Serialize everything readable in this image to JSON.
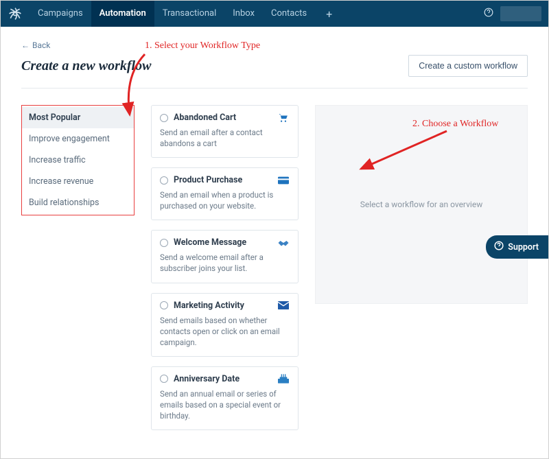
{
  "nav": {
    "tabs": [
      "Campaigns",
      "Automation",
      "Transactional",
      "Inbox",
      "Contacts"
    ],
    "active_index": 1
  },
  "back_label": "Back",
  "page_title": "Create a new workflow",
  "custom_button": "Create a custom workflow",
  "sidebar": {
    "items": [
      {
        "label": "Most Popular",
        "active": true
      },
      {
        "label": "Improve engagement",
        "active": false
      },
      {
        "label": "Increase traffic",
        "active": false
      },
      {
        "label": "Increase revenue",
        "active": false
      },
      {
        "label": "Build relationships",
        "active": false
      }
    ]
  },
  "workflows": [
    {
      "title": "Abandoned Cart",
      "desc": "Send an email after a contact abandons a cart",
      "icon": "cart-icon",
      "icon_color": "#1e73be"
    },
    {
      "title": "Product Purchase",
      "desc": "Send an email when a product is purchased on your website.",
      "icon": "card-icon",
      "icon_color": "#1e73be"
    },
    {
      "title": "Welcome Message",
      "desc": "Send a welcome email after a subscriber joins your list.",
      "icon": "handshake-icon",
      "icon_color": "#3b82c4"
    },
    {
      "title": "Marketing Activity",
      "desc": "Send emails based on whether contacts open or click on an email campaign.",
      "icon": "envelope-icon",
      "icon_color": "#1e5aa8"
    },
    {
      "title": "Anniversary Date",
      "desc": "Send an annual email or series of emails based on a special event or birthday.",
      "icon": "cake-icon",
      "icon_color": "#2b7fc3"
    }
  ],
  "preview_placeholder": "Select a workflow for an overview",
  "support_label": "Support",
  "annotation_1": "1. Select your Workflow Type",
  "annotation_2": "2. Choose a Workflow"
}
